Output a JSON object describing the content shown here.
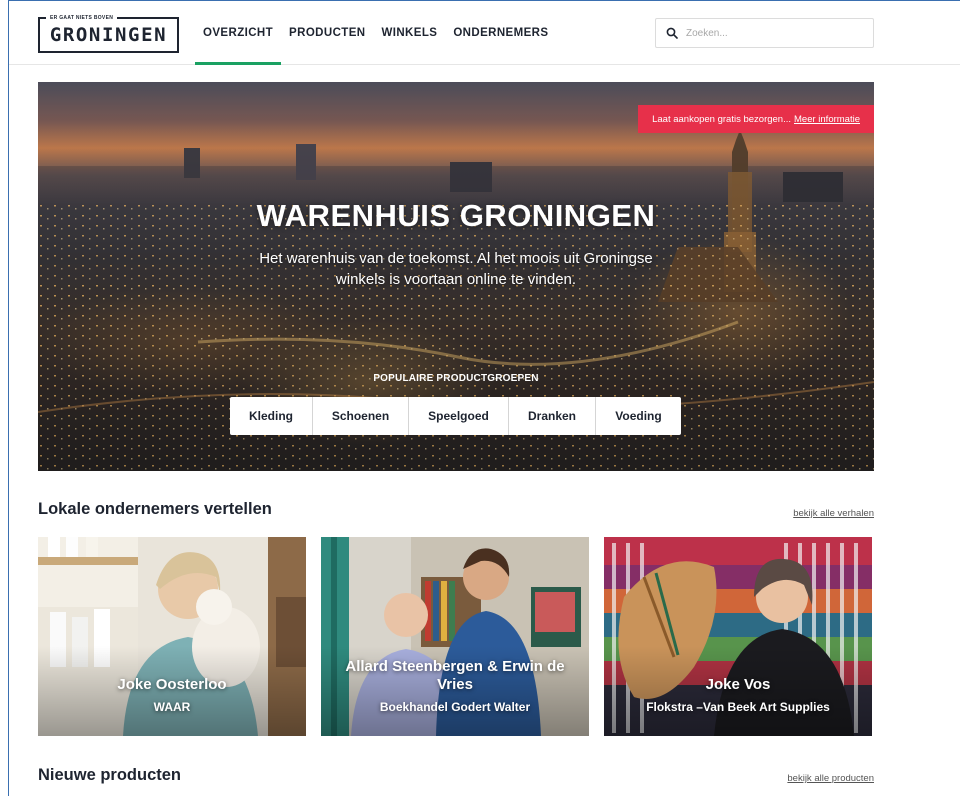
{
  "header": {
    "logo": {
      "tagline": "ER GAAT NIETS BOVEN",
      "wordmark": "GRONINGEN"
    },
    "nav": [
      {
        "label": "OVERZICHT",
        "active": true
      },
      {
        "label": "PRODUCTEN",
        "active": false
      },
      {
        "label": "WINKELS",
        "active": false
      },
      {
        "label": "ONDERNEMERS",
        "active": false
      }
    ],
    "search": {
      "placeholder": "Zoeken...",
      "value": ""
    }
  },
  "hero": {
    "banner_text": "Laat aankopen gratis bezorgen...",
    "banner_link": "Meer informatie",
    "title": "WARENHUIS GRONINGEN",
    "subtitle": "Het warenhuis van de toekomst. Al het moois uit Groningse winkels is voortaan online te vinden.",
    "groups_label": "POPULAIRE PRODUCTGROEPEN",
    "groups": [
      "Kleding",
      "Schoenen",
      "Speelgoed",
      "Dranken",
      "Voeding"
    ]
  },
  "stories": {
    "title": "Lokale ondernemers vertellen",
    "link": "bekijk alle verhalen",
    "cards": [
      {
        "name": "Joke Oosterloo",
        "shop": "WAAR"
      },
      {
        "name": "Allard Steenbergen & Erwin de Vries",
        "shop": "Boekhandel Godert Walter"
      },
      {
        "name": "Joke Vos",
        "shop": "Flokstra –Van Beek Art Supplies"
      }
    ]
  },
  "products": {
    "title": "Nieuwe producten",
    "link": "bekijk alle producten"
  },
  "colors": {
    "accent_green": "#1aa162",
    "banner_red": "#e7304a",
    "text_dark": "#1e2430"
  }
}
